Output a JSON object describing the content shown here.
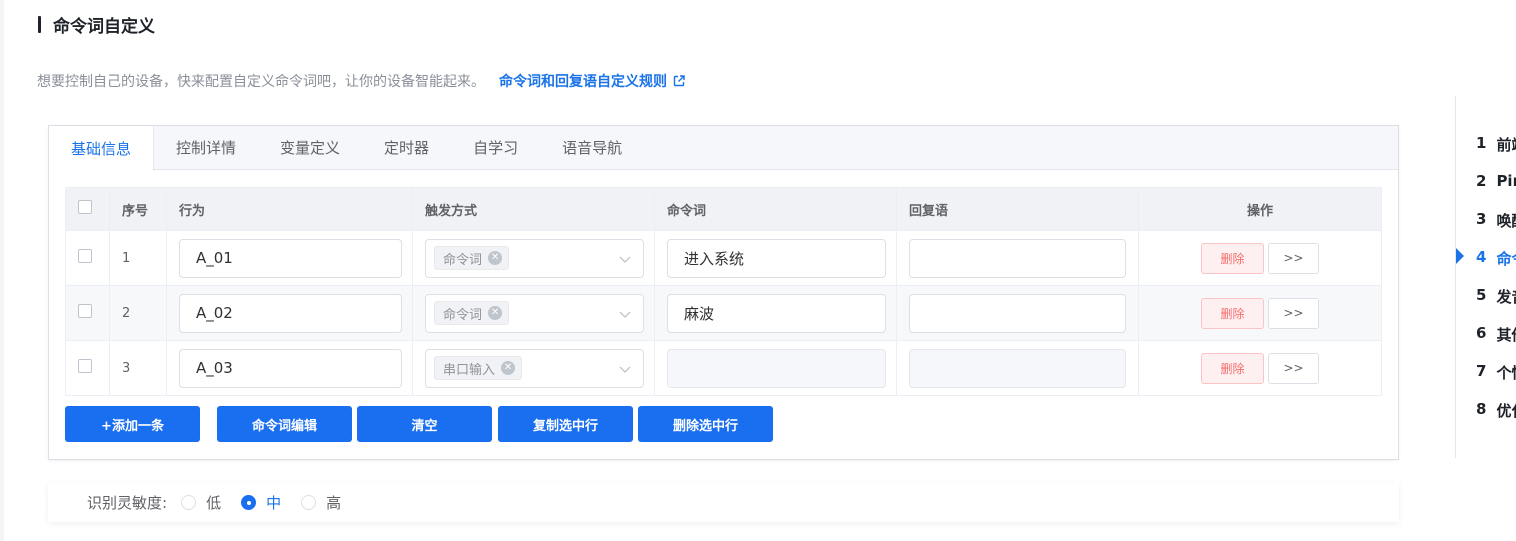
{
  "section": {
    "title": "命令词自定义"
  },
  "description": {
    "text": "想要控制自己的设备，快来配置自定义命令词吧，让你的设备智能起来。",
    "link": "命令词和回复语自定义规则"
  },
  "tabs": [
    "基础信息",
    "控制详情",
    "变量定义",
    "定时器",
    "自学习",
    "语音导航"
  ],
  "table": {
    "headers": {
      "index": "序号",
      "action": "行为",
      "trigger": "触发方式",
      "command": "命令词",
      "reply": "回复语",
      "operation": "操作"
    },
    "rows": [
      {
        "index": "1",
        "action": "A_01",
        "trigger": "命令词",
        "command": "进入系统",
        "reply": ""
      },
      {
        "index": "2",
        "action": "A_02",
        "trigger": "命令词",
        "command": "麻波",
        "reply": ""
      },
      {
        "index": "3",
        "action": "A_03",
        "trigger": "串口输入",
        "command": "",
        "reply": ""
      }
    ],
    "delete_label": "删除",
    "more_label": ">>"
  },
  "actions": {
    "add": "+添加一条",
    "edit_commands": "命令词编辑",
    "clear": "清空",
    "copy_selected": "复制选中行",
    "delete_selected": "删除选中行"
  },
  "sensitivity": {
    "label": "识别灵敏度:",
    "options": [
      "低",
      "中",
      "高"
    ],
    "selected": "中"
  },
  "toc": {
    "items": [
      {
        "num": "1",
        "text": "前端"
      },
      {
        "num": "2",
        "text": "Pin"
      },
      {
        "num": "3",
        "text": "唤醒"
      },
      {
        "num": "4",
        "text": "命令"
      },
      {
        "num": "5",
        "text": "发音"
      },
      {
        "num": "6",
        "text": "其他"
      },
      {
        "num": "7",
        "text": "个性"
      },
      {
        "num": "8",
        "text": "优化"
      }
    ],
    "active_index": 3
  },
  "colors": {
    "accent": "#1a6ff0",
    "link": "#1a73e8",
    "danger": "#f56c6c"
  }
}
